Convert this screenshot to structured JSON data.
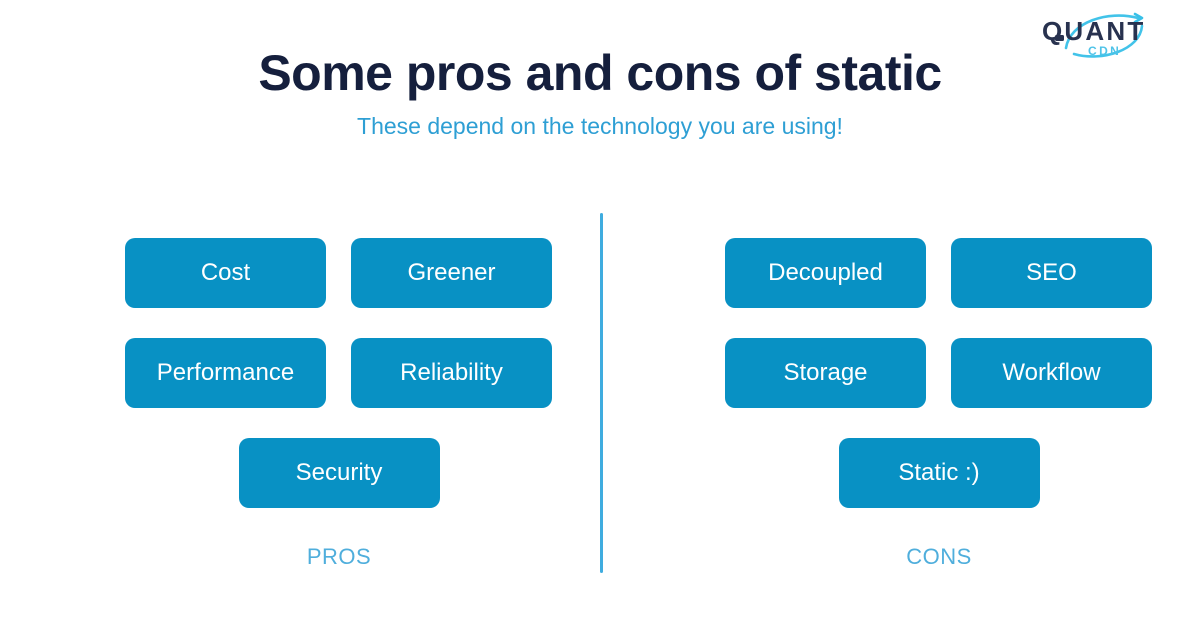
{
  "brand": {
    "name": "QUANT",
    "sub": "CDN",
    "wordmark_color": "#28324f",
    "sub_color": "#4fc3e8",
    "swoosh_color": "#38c0e8"
  },
  "header": {
    "title": "Some pros and cons of static",
    "subtitle": "These depend on the technology you are using!",
    "title_color": "#151f3d",
    "subtitle_color": "#2e9fd4"
  },
  "theme": {
    "background": "#ffffff",
    "chip_fill": "#0891c4",
    "chip_text": "#ffffff",
    "divider": "#3facdf",
    "label_color": "#4faedc"
  },
  "columns": [
    {
      "id": "pros",
      "label": "PROS",
      "rows": [
        [
          "Cost",
          "Greener"
        ],
        [
          "Performance",
          "Reliability"
        ],
        [
          "Security"
        ]
      ]
    },
    {
      "id": "cons",
      "label": "CONS",
      "rows": [
        [
          "Decoupled",
          "SEO"
        ],
        [
          "Storage",
          "Workflow"
        ],
        [
          "Static :)"
        ]
      ]
    }
  ]
}
